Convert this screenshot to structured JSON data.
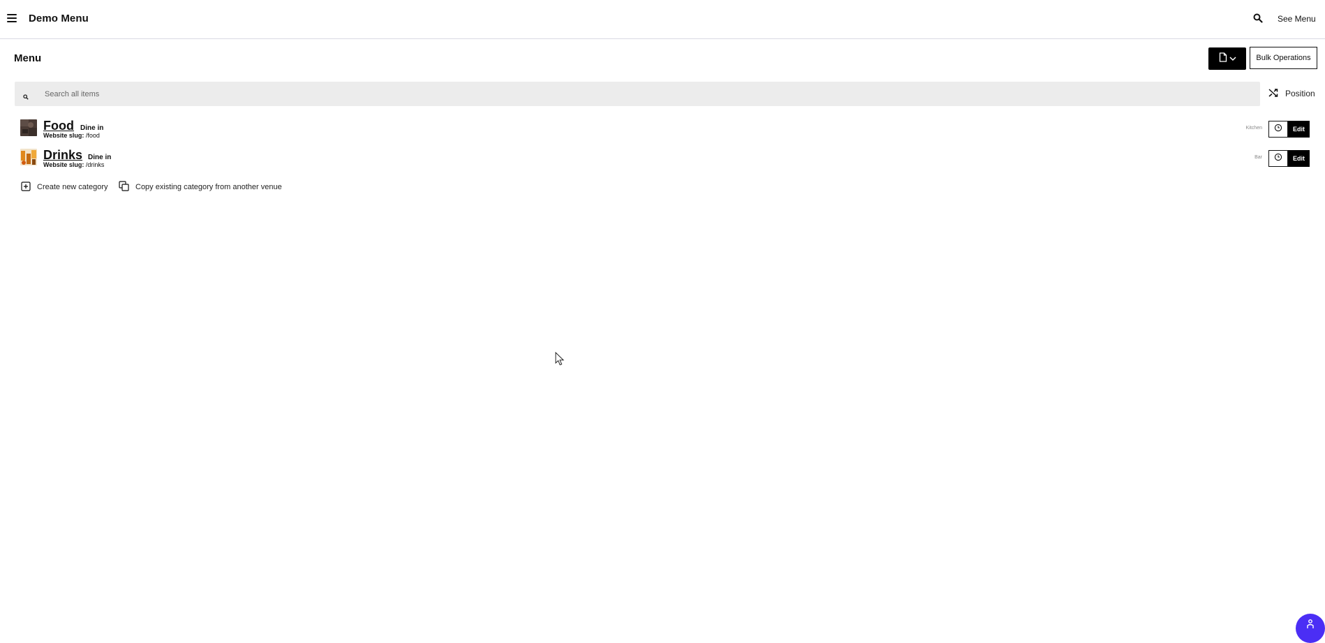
{
  "header": {
    "app_title": "Demo Menu",
    "see_menu_label": "See Menu"
  },
  "page": {
    "title": "Menu",
    "bulk_operations_label": "Bulk Operations"
  },
  "search": {
    "placeholder": "Search all items",
    "value": ""
  },
  "sort": {
    "position_label": "Position"
  },
  "categories": [
    {
      "name": "Food",
      "mode": "Dine in",
      "slug_label": "Website slug:",
      "slug": "/food",
      "station": "Kitchen",
      "edit_label": "Edit"
    },
    {
      "name": "Drinks",
      "mode": "Dine in",
      "slug_label": "Website slug:",
      "slug": "/drinks",
      "station": "Bar",
      "edit_label": "Edit"
    }
  ],
  "actions": {
    "create_category": "Create new category",
    "copy_category": "Copy existing category from another venue"
  },
  "colors": {
    "accent": "#4b2ef5",
    "primary_button": "#000000",
    "search_bg": "#ececec"
  }
}
